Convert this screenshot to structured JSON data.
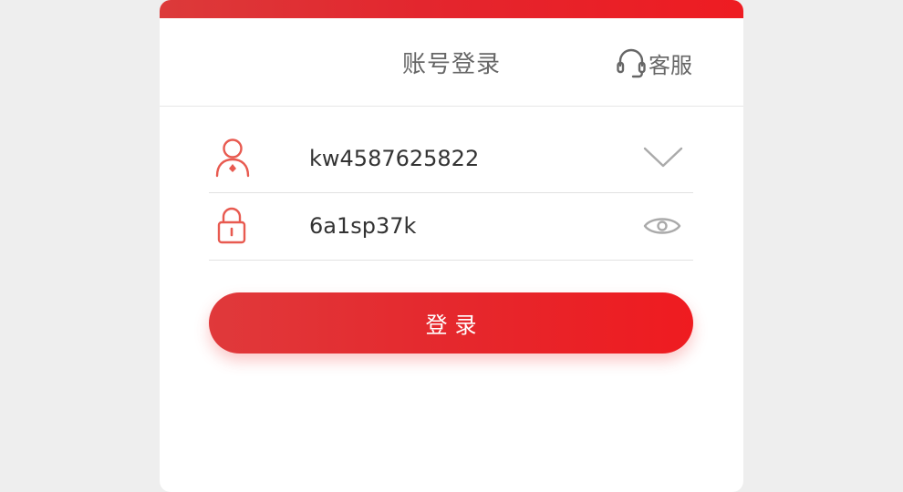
{
  "header": {
    "title": "账号登录",
    "service_label": "客服",
    "service_icon": "headset-icon"
  },
  "form": {
    "username": {
      "value": "kw4587625822",
      "lead_icon": "user-icon",
      "trail_icon": "chevron-down-icon"
    },
    "password": {
      "value": "6a1sp37k",
      "lead_icon": "lock-icon",
      "trail_icon": "eye-icon"
    },
    "submit_label": "登录"
  },
  "colors": {
    "accent": "#e5282d",
    "accent_light": "#ef1b20",
    "icon_red": "#e85a50",
    "text": "#666666",
    "background": "#eeeeee"
  }
}
